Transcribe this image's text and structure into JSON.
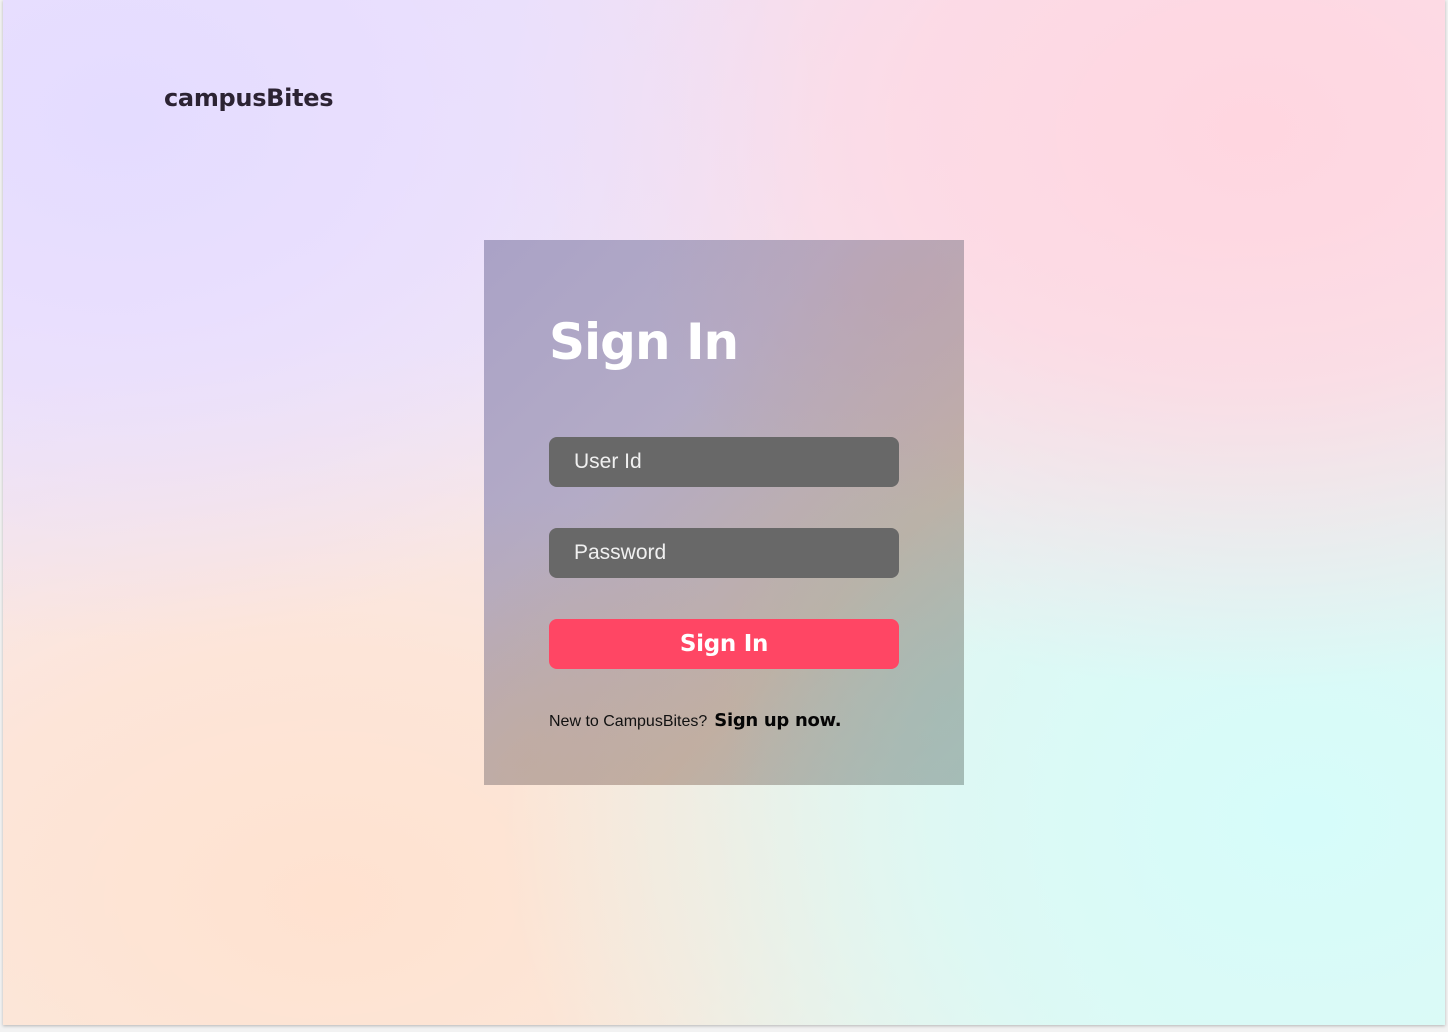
{
  "app": {
    "brand": "campusBites"
  },
  "signin": {
    "title": "Sign In",
    "userid_placeholder": "User Id",
    "userid_value": "",
    "password_placeholder": "Password",
    "password_value": "",
    "submit_label": "Sign In",
    "signup_prompt": "New to CampusBites?",
    "signup_link": "Sign up now."
  },
  "colors": {
    "accent": "#ff4664",
    "input_bg": "#686868",
    "logo_text": "#2c2333"
  }
}
